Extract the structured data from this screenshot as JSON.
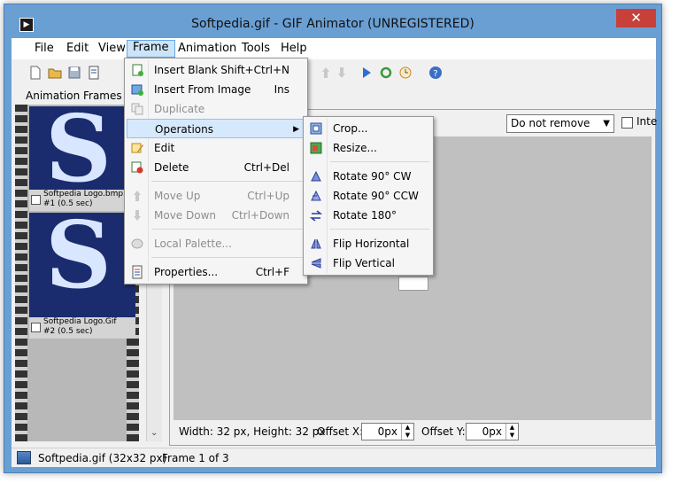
{
  "window": {
    "title": "Softpedia.gif - GIF Animator (UNREGISTERED)",
    "close": "✕"
  },
  "menubar": {
    "items": [
      "File",
      "Edit",
      "View",
      "Frame",
      "Animation",
      "Tools",
      "Help"
    ]
  },
  "panels": {
    "frames_header": "Animation Frames"
  },
  "frames": [
    {
      "letter": "S",
      "name": "Softpedia Logo.bmp",
      "info": "#1 (0.5 sec)"
    },
    {
      "letter": "S",
      "name": "Softpedia Logo.Gif",
      "info": "#2 (0.5 sec)"
    }
  ],
  "canvas": {
    "remove_select": "Do not remove",
    "inte_label": "Inte"
  },
  "props": {
    "size_text": "Width: 32 px, Height: 32 px",
    "offset_x_label": "Offset X:",
    "offset_x_value": "0px",
    "offset_y_label": "Offset Y:",
    "offset_y_value": "0px"
  },
  "status": {
    "file": "Softpedia.gif (32x32 px)",
    "frame": "Frame 1 of 3"
  },
  "frame_menu": [
    {
      "label": "Insert Blank",
      "shortcut": "Shift+Ctrl+N",
      "icon": "insert-blank-icon",
      "disabled": false
    },
    {
      "label": "Insert From Image",
      "shortcut": "Ins",
      "icon": "insert-image-icon",
      "disabled": false
    },
    {
      "label": "Duplicate",
      "shortcut": "",
      "icon": "duplicate-icon",
      "disabled": true
    },
    {
      "label": "Operations",
      "shortcut": "",
      "icon": "",
      "disabled": false,
      "submenu": true
    },
    {
      "label": "Edit",
      "shortcut": "",
      "icon": "edit-icon",
      "disabled": false
    },
    {
      "label": "Delete",
      "shortcut": "Ctrl+Del",
      "icon": "delete-icon",
      "disabled": false
    },
    {
      "label": "Move Up",
      "shortcut": "Ctrl+Up",
      "icon": "move-up-icon",
      "disabled": true
    },
    {
      "label": "Move Down",
      "shortcut": "Ctrl+Down",
      "icon": "move-down-icon",
      "disabled": true
    },
    {
      "label": "Local Palette...",
      "shortcut": "",
      "icon": "palette-icon",
      "disabled": true
    },
    {
      "label": "Properties...",
      "shortcut": "Ctrl+F",
      "icon": "properties-icon",
      "disabled": false
    }
  ],
  "operations_menu": [
    {
      "label": "Crop...",
      "icon": "crop-icon"
    },
    {
      "label": "Resize...",
      "icon": "resize-icon"
    },
    {
      "label": "Rotate 90° CW",
      "icon": "rotate-cw-icon"
    },
    {
      "label": "Rotate 90° CCW",
      "icon": "rotate-ccw-icon"
    },
    {
      "label": "Rotate 180°",
      "icon": "rotate-180-icon"
    },
    {
      "label": "Flip Horizontal",
      "icon": "flip-horizontal-icon"
    },
    {
      "label": "Flip Vertical",
      "icon": "flip-vertical-icon"
    }
  ],
  "colors": {
    "titlebar": "#6a9fd4",
    "close": "#c7403a",
    "thumb_bg": "#1a2b6e",
    "canvas": "#c0c0c0"
  }
}
